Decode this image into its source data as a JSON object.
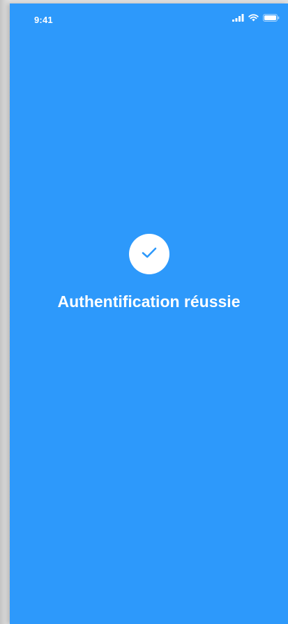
{
  "status_bar": {
    "time": "9:41",
    "icons": [
      "signal-icon",
      "wifi-icon",
      "battery-icon"
    ]
  },
  "main": {
    "icon": "checkmark-icon",
    "title": "Authentification réussie"
  },
  "colors": {
    "background": "#2d99fb",
    "foreground": "#ffffff",
    "check": "#2d99fb"
  }
}
